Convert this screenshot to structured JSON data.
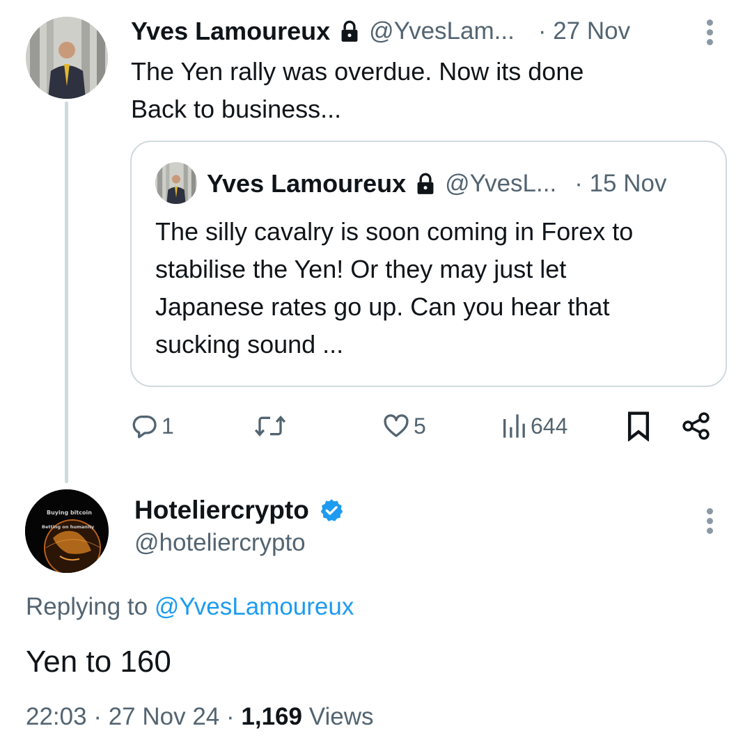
{
  "parent_tweet": {
    "author_name": "Yves Lamoureux",
    "author_handle": "@YvesLam...",
    "date": "· 27 Nov",
    "text_line1": "The Yen rally was overdue. Now its done",
    "text_line2": "Back to business...",
    "quoted": {
      "author_name": "Yves Lamoureux",
      "author_handle": "@YvesL...",
      "date": "· 15 Nov",
      "text_line1": "The silly cavalry is soon coming in Forex to",
      "text_line2": "stabilise the Yen! Or they may just let",
      "text_line3": "Japanese rates go up. Can you hear that",
      "text_line4": "sucking sound ..."
    },
    "actions": {
      "replies": "1",
      "reposts": "",
      "likes": "5",
      "views": "644"
    }
  },
  "reply_tweet": {
    "author_name": "Hoteliercrypto",
    "author_handle": "@hoteliercrypto",
    "replying_prefix": "Replying to",
    "replying_to": "@YvesLamoureux",
    "text": "Yen to 160",
    "time": "22:03",
    "date": "27 Nov 24",
    "views_count": "1,169",
    "views_label": "Views",
    "avatar_text_1": "Buying bitcoin",
    "avatar_text_2": "Betting on humanity"
  },
  "colors": {
    "accent": "#1d9bf0",
    "muted": "#536471",
    "border": "#cfd9de"
  },
  "icons": [
    "lock-icon",
    "more-icon",
    "reply-icon",
    "repost-icon",
    "like-icon",
    "views-icon",
    "bookmark-icon",
    "share-icon",
    "verified-badge-icon"
  ]
}
